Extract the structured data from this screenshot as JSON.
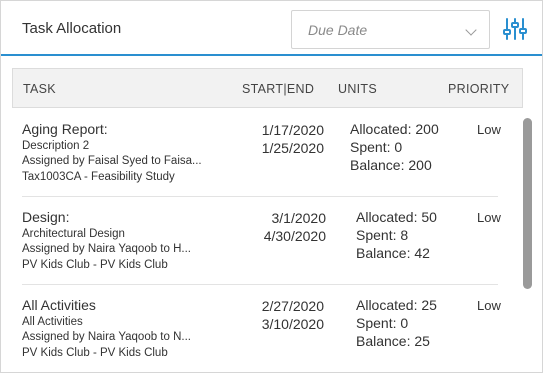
{
  "header": {
    "title": "Task Allocation",
    "date_select_placeholder": "Due Date"
  },
  "icons": {
    "filter": "sliders-icon",
    "dropdown": "chevron-down-icon",
    "accent_color": "#2a8fd0"
  },
  "columns": {
    "task": "TASK",
    "dates": "START|END",
    "units": "UNITS",
    "priority": "PRIORITY"
  },
  "rows": [
    {
      "name": "Aging Report:",
      "description": "Description 2",
      "assigned": "Assigned by Faisal Syed to Faisa...",
      "project": "Tax1003CA - Feasibility Study",
      "start": "1/17/2020",
      "end": "1/25/2020",
      "allocated": "Allocated: 200",
      "spent": "Spent: 0",
      "balance": "Balance: 200",
      "priority": "Low"
    },
    {
      "name": "Design:",
      "description": "Architectural Design",
      "assigned": "Assigned by Naira Yaqoob to H...",
      "project": "PV Kids Club - PV Kids Club",
      "start": "3/1/2020",
      "end": "4/30/2020",
      "allocated": "Allocated: 50",
      "spent": "Spent: 8",
      "balance": "Balance: 42",
      "priority": "Low"
    },
    {
      "name": "All Activities",
      "description": "All Activities",
      "assigned": "Assigned by Naira Yaqoob to N...",
      "project": "PV Kids Club - PV Kids Club",
      "start": "2/27/2020",
      "end": "3/10/2020",
      "allocated": "Allocated: 25",
      "spent": "Spent: 0",
      "balance": "Balance: 25",
      "priority": "Low"
    }
  ]
}
